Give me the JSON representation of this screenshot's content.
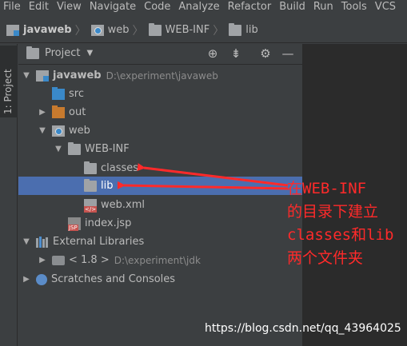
{
  "menubar": {
    "items": [
      "File",
      "Edit",
      "View",
      "Navigate",
      "Code",
      "Analyze",
      "Refactor",
      "Build",
      "Run",
      "Tools",
      "VCS"
    ]
  },
  "breadcrumb": {
    "items": [
      "javaweb",
      "web",
      "WEB-INF",
      "lib"
    ]
  },
  "side_tab": {
    "label": "1: Project"
  },
  "project_panel": {
    "title": "Project",
    "header_icons": [
      "locate-icon",
      "collapse-all-icon",
      "gear-icon",
      "hide-icon"
    ],
    "tree": [
      {
        "label": "javaweb",
        "path": "D:\\experiment\\javaweb",
        "icon": "module-icon",
        "expanded": true
      },
      {
        "label": "src",
        "icon": "source-folder-icon"
      },
      {
        "label": "out",
        "icon": "excluded-folder-icon",
        "expanded": false
      },
      {
        "label": "web",
        "icon": "web-folder-icon",
        "expanded": true
      },
      {
        "label": "WEB-INF",
        "icon": "folder-icon",
        "expanded": true
      },
      {
        "label": "classes",
        "icon": "folder-icon"
      },
      {
        "label": "lib",
        "icon": "folder-icon",
        "selected": true
      },
      {
        "label": "web.xml",
        "icon": "xml-file-icon"
      },
      {
        "label": "index.jsp",
        "icon": "jsp-file-icon"
      },
      {
        "label": "External Libraries",
        "icon": "libraries-icon",
        "expanded": true
      },
      {
        "label": "< 1.8 >",
        "path": "D:\\experiment\\jdk",
        "icon": "jdk-icon",
        "expanded": false
      },
      {
        "label": "Scratches and Consoles",
        "icon": "scratches-icon",
        "expanded": false
      }
    ]
  },
  "annotation": {
    "lines": [
      "在WEB-INF",
      "的目录下建立",
      "classes和lib",
      "两个文件夹"
    ],
    "color": "#ff2a2a"
  },
  "watermark": "https://blog.csdn.net/qq_43964025",
  "colors": {
    "background": "#3c3f41",
    "editor": "#2b2b2b",
    "selection": "#4b6eaf",
    "text": "#bbbbbb"
  }
}
